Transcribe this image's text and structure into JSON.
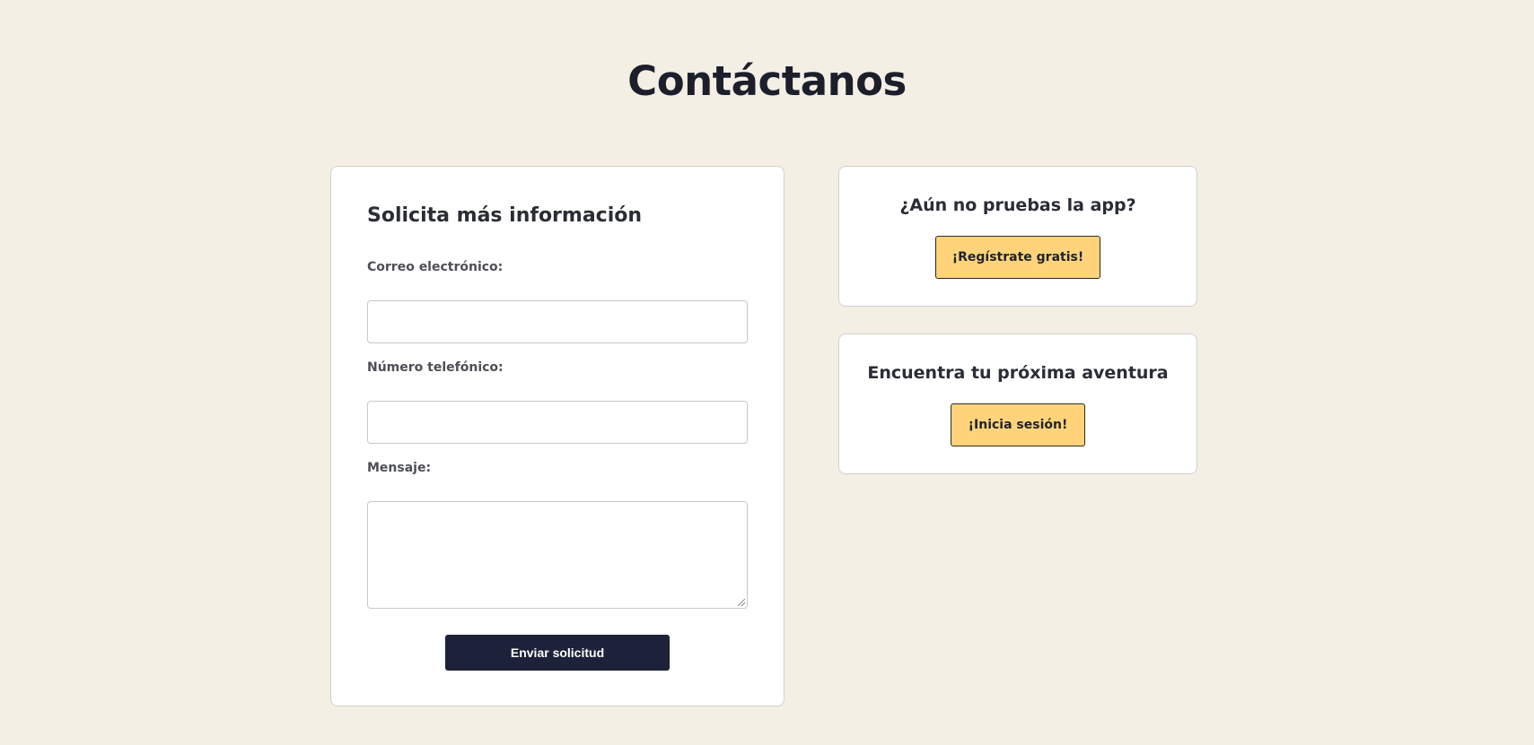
{
  "page": {
    "title": "Contáctanos"
  },
  "form": {
    "title": "Solicita más información",
    "email_label": "Correo electrónico:",
    "email_value": "",
    "phone_label": "Número telefónico:",
    "phone_value": "",
    "message_label": "Mensaje:",
    "message_value": "",
    "submit_label": "Enviar solicitud"
  },
  "promos": [
    {
      "heading": "¿Aún no pruebas la app?",
      "button_label": "¡Regístrate gratis!"
    },
    {
      "heading": "Encuentra tu próxima aventura",
      "button_label": "¡Inicia sesión!"
    }
  ],
  "colors": {
    "background": "#f4efe5",
    "primary_button": "#1d2139",
    "accent_button": "#ffd37a"
  }
}
